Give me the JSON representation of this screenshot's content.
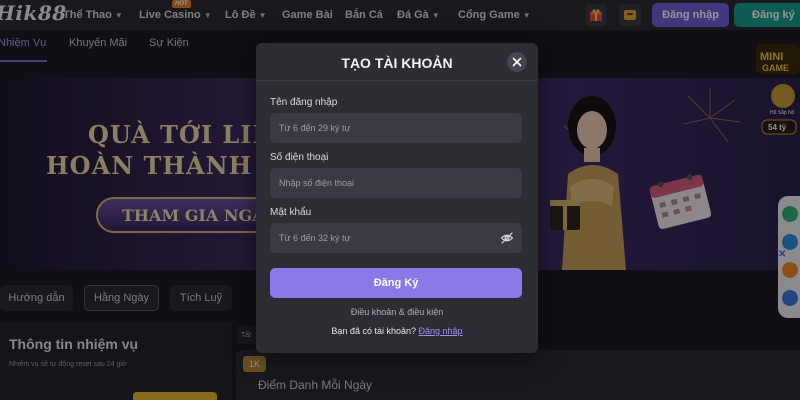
{
  "brand": {
    "logo_text": "Hik88"
  },
  "topnav": {
    "items": [
      {
        "label": "Thể Thao",
        "has_dropdown": true
      },
      {
        "label": "Live Casino",
        "has_dropdown": true,
        "badge": "HOT"
      },
      {
        "label": "Lô Đề",
        "has_dropdown": true
      },
      {
        "label": "Game Bài",
        "has_dropdown": false
      },
      {
        "label": "Bắn Cá",
        "has_dropdown": false
      },
      {
        "label": "Đá Gà",
        "has_dropdown": true
      },
      {
        "label": "Cổng Game",
        "has_dropdown": true
      }
    ],
    "login_label": "Đăng nhập",
    "signup_label": "Đăng ký"
  },
  "subtabs": [
    {
      "label": "Nhiệm Vụ",
      "active": true
    },
    {
      "label": "Khuyến Mãi",
      "active": false
    },
    {
      "label": "Sự Kiện",
      "active": false
    }
  ],
  "banner": {
    "line1": "QUÀ TỚI LIỀN T",
    "line2": "HOÀN THÀNH NH",
    "cta": "THAM GIA NGAY"
  },
  "minigame": {
    "label": "MINI GAME",
    "sub": "Hũ Sắp Nổ",
    "amount": "54 tỷ"
  },
  "lower_tabs": [
    {
      "label": "Hướng dẫn",
      "active": false
    },
    {
      "label": "Hằng Ngày",
      "active": true
    },
    {
      "label": "Tích Luỹ",
      "active": false
    }
  ],
  "mission_panel": {
    "title": "Thông tin nhiệm vụ",
    "subtitle": "Nhiệm vụ sẽ tự động reset sau 24 giờ"
  },
  "card": {
    "tag": "1K",
    "title": "Điểm Danh Mỗi Ngày",
    "mini_tab": "Tất"
  },
  "modal": {
    "title": "TẠO TÀI KHOẢN",
    "username": {
      "label": "Tên đăng nhập",
      "placeholder": "Từ 6 đến 29 ký tự",
      "value": ""
    },
    "phone": {
      "label": "Số điện thoại",
      "placeholder": "Nhập số điện thoại",
      "value": ""
    },
    "password": {
      "label": "Mật khẩu",
      "placeholder": "Từ 6 đến 32 ký tự",
      "value": ""
    },
    "submit_label": "Đăng Ký",
    "terms_label": "Điều khoản & điều kiện",
    "have_account_text": "Bạn đã có tài khoản?",
    "login_link": "Đăng nhập"
  },
  "colors": {
    "accent": "#8a79e8",
    "login_button": "#6f5fd6",
    "signup_button": "#1b9c8c",
    "modal_bg": "#2c2c33",
    "input_bg": "#3a3a43"
  },
  "icons": [
    "gift-icon",
    "wallet-icon",
    "close-icon",
    "eye-off-icon",
    "chevron-down-icon"
  ]
}
